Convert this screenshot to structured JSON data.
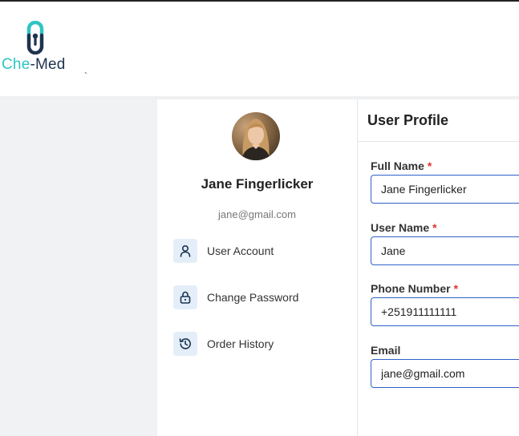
{
  "brand": {
    "che": "Che",
    "med": "-Med",
    "tick": "`",
    "accent": "#2ec4c4",
    "dark": "#1d3350"
  },
  "profile": {
    "name": "Jane Fingerlicker",
    "email": "jane@gmail.com"
  },
  "menu": [
    {
      "label": "User Account",
      "icon": "user-icon"
    },
    {
      "label": "Change Password",
      "icon": "lock-icon"
    },
    {
      "label": "Order History",
      "icon": "history-icon"
    }
  ],
  "form": {
    "title": "User Profile",
    "required_mark": "*",
    "fields": [
      {
        "label": "Full Name",
        "required": true,
        "value": "Jane Fingerlicker"
      },
      {
        "label": "User Name",
        "required": true,
        "value": "Jane"
      },
      {
        "label": "Phone Number",
        "required": true,
        "value": "+251911111111"
      },
      {
        "label": "Email",
        "required": false,
        "value": "jane@gmail.com"
      }
    ]
  }
}
